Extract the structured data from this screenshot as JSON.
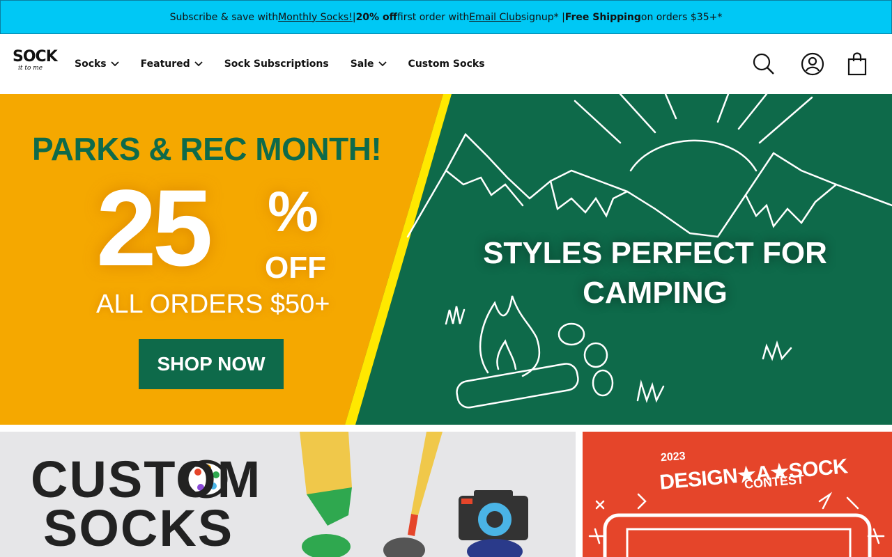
{
  "announcement": {
    "part1": "Subscribe & save with ",
    "link1": "Monthly Socks!",
    "sep1": " | ",
    "bold1": "20% off",
    "part2": " first order with ",
    "link2": "Email Club",
    "part3": " signup* | ",
    "bold2": "Free Shipping",
    "part4": " on orders $35+*"
  },
  "header": {
    "logo_top": "SOCK",
    "logo_bottom": "it to me",
    "nav": [
      {
        "label": "Socks",
        "icon": "chevron-down-icon"
      },
      {
        "label": "Featured",
        "icon": "chevron-down-icon"
      },
      {
        "label": "Sock Subscriptions"
      },
      {
        "label": "Sale",
        "icon": "chevron-down-icon"
      },
      {
        "label": "Custom Socks"
      }
    ],
    "icons": [
      "search-icon",
      "account-icon",
      "cart-icon"
    ]
  },
  "hero": {
    "headline": "PARKS & REC MONTH!",
    "big_number": "25",
    "percent": "%",
    "off": "OFF",
    "subline": "ALL ORDERS $50+",
    "cta": "SHOP NOW",
    "right_text": "STYLES PERFECT FOR CAMPING"
  },
  "tiles": {
    "custom_line1": "CUSTOM",
    "custom_line2": "SOCKS",
    "contest_year": "2023",
    "contest_title": "DESIGN★A★SOCK",
    "contest_sub": "CONTEST"
  },
  "colors": {
    "announcement_bg": "#00c8f5",
    "hero_orange": "#f5a800",
    "hero_green": "#0e6a4a",
    "hero_stripe": "#ffe800",
    "contest_red": "#e5452a"
  }
}
